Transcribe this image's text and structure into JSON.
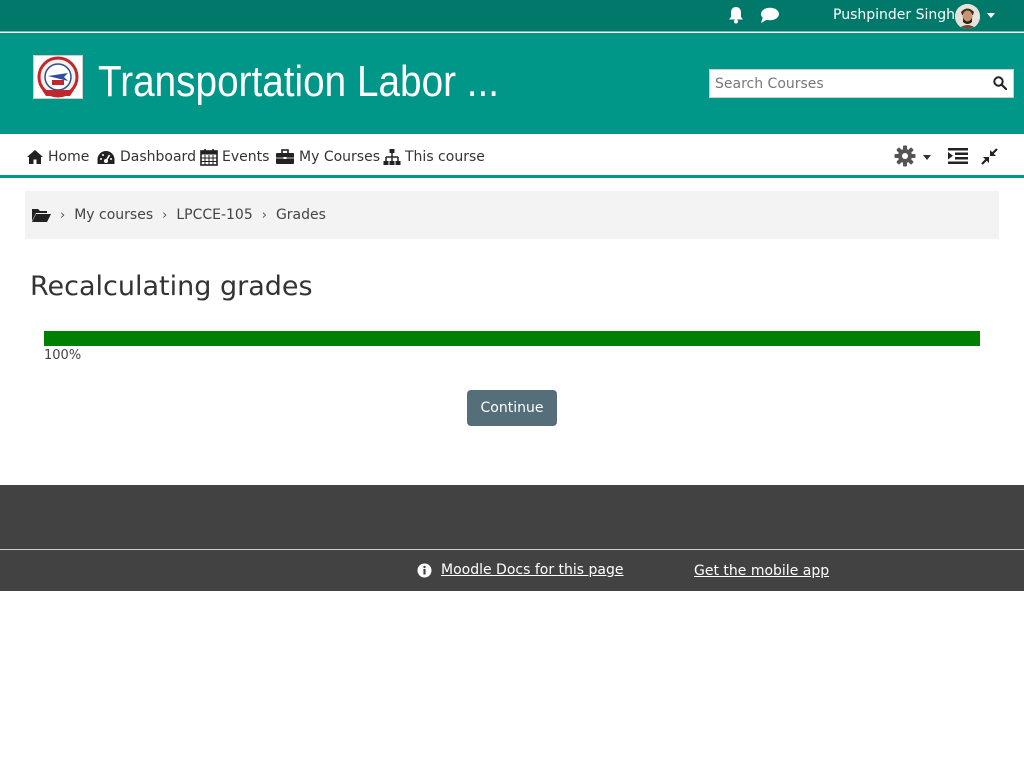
{
  "topbar": {
    "username": "Pushpinder Singh",
    "icons": [
      "bell-icon",
      "chat-icon",
      "avatar",
      "chevron-down-icon"
    ]
  },
  "header": {
    "site_name": "Transportation Labor ...",
    "search_placeholder": "Search Courses",
    "search_icon": "search-icon"
  },
  "nav": {
    "items": [
      {
        "label": "Home",
        "icon": "home-icon"
      },
      {
        "label": "Dashboard",
        "icon": "dashboard-icon"
      },
      {
        "label": "Events",
        "icon": "calendar-icon"
      },
      {
        "label": "My Courses",
        "icon": "briefcase-icon"
      },
      {
        "label": "This course",
        "icon": "sitemap-icon"
      }
    ],
    "right_icons": [
      "gear-icon",
      "indent-icon",
      "collapse-icon"
    ]
  },
  "breadcrumb": {
    "items": [
      "My courses",
      "LPCCE-105",
      "Grades"
    ]
  },
  "main": {
    "title": "Recalculating grades",
    "progress_value": 1.0,
    "progress_text": "100%",
    "continue_label": "Continue"
  },
  "footer": {
    "docs_link": "Moodle Docs for this page",
    "app_link": "Get the mobile app"
  },
  "colors": {
    "topbar": "#00796b",
    "header": "#009688",
    "progress": "#008000",
    "button": "#546e7a",
    "footer": "#424242"
  }
}
